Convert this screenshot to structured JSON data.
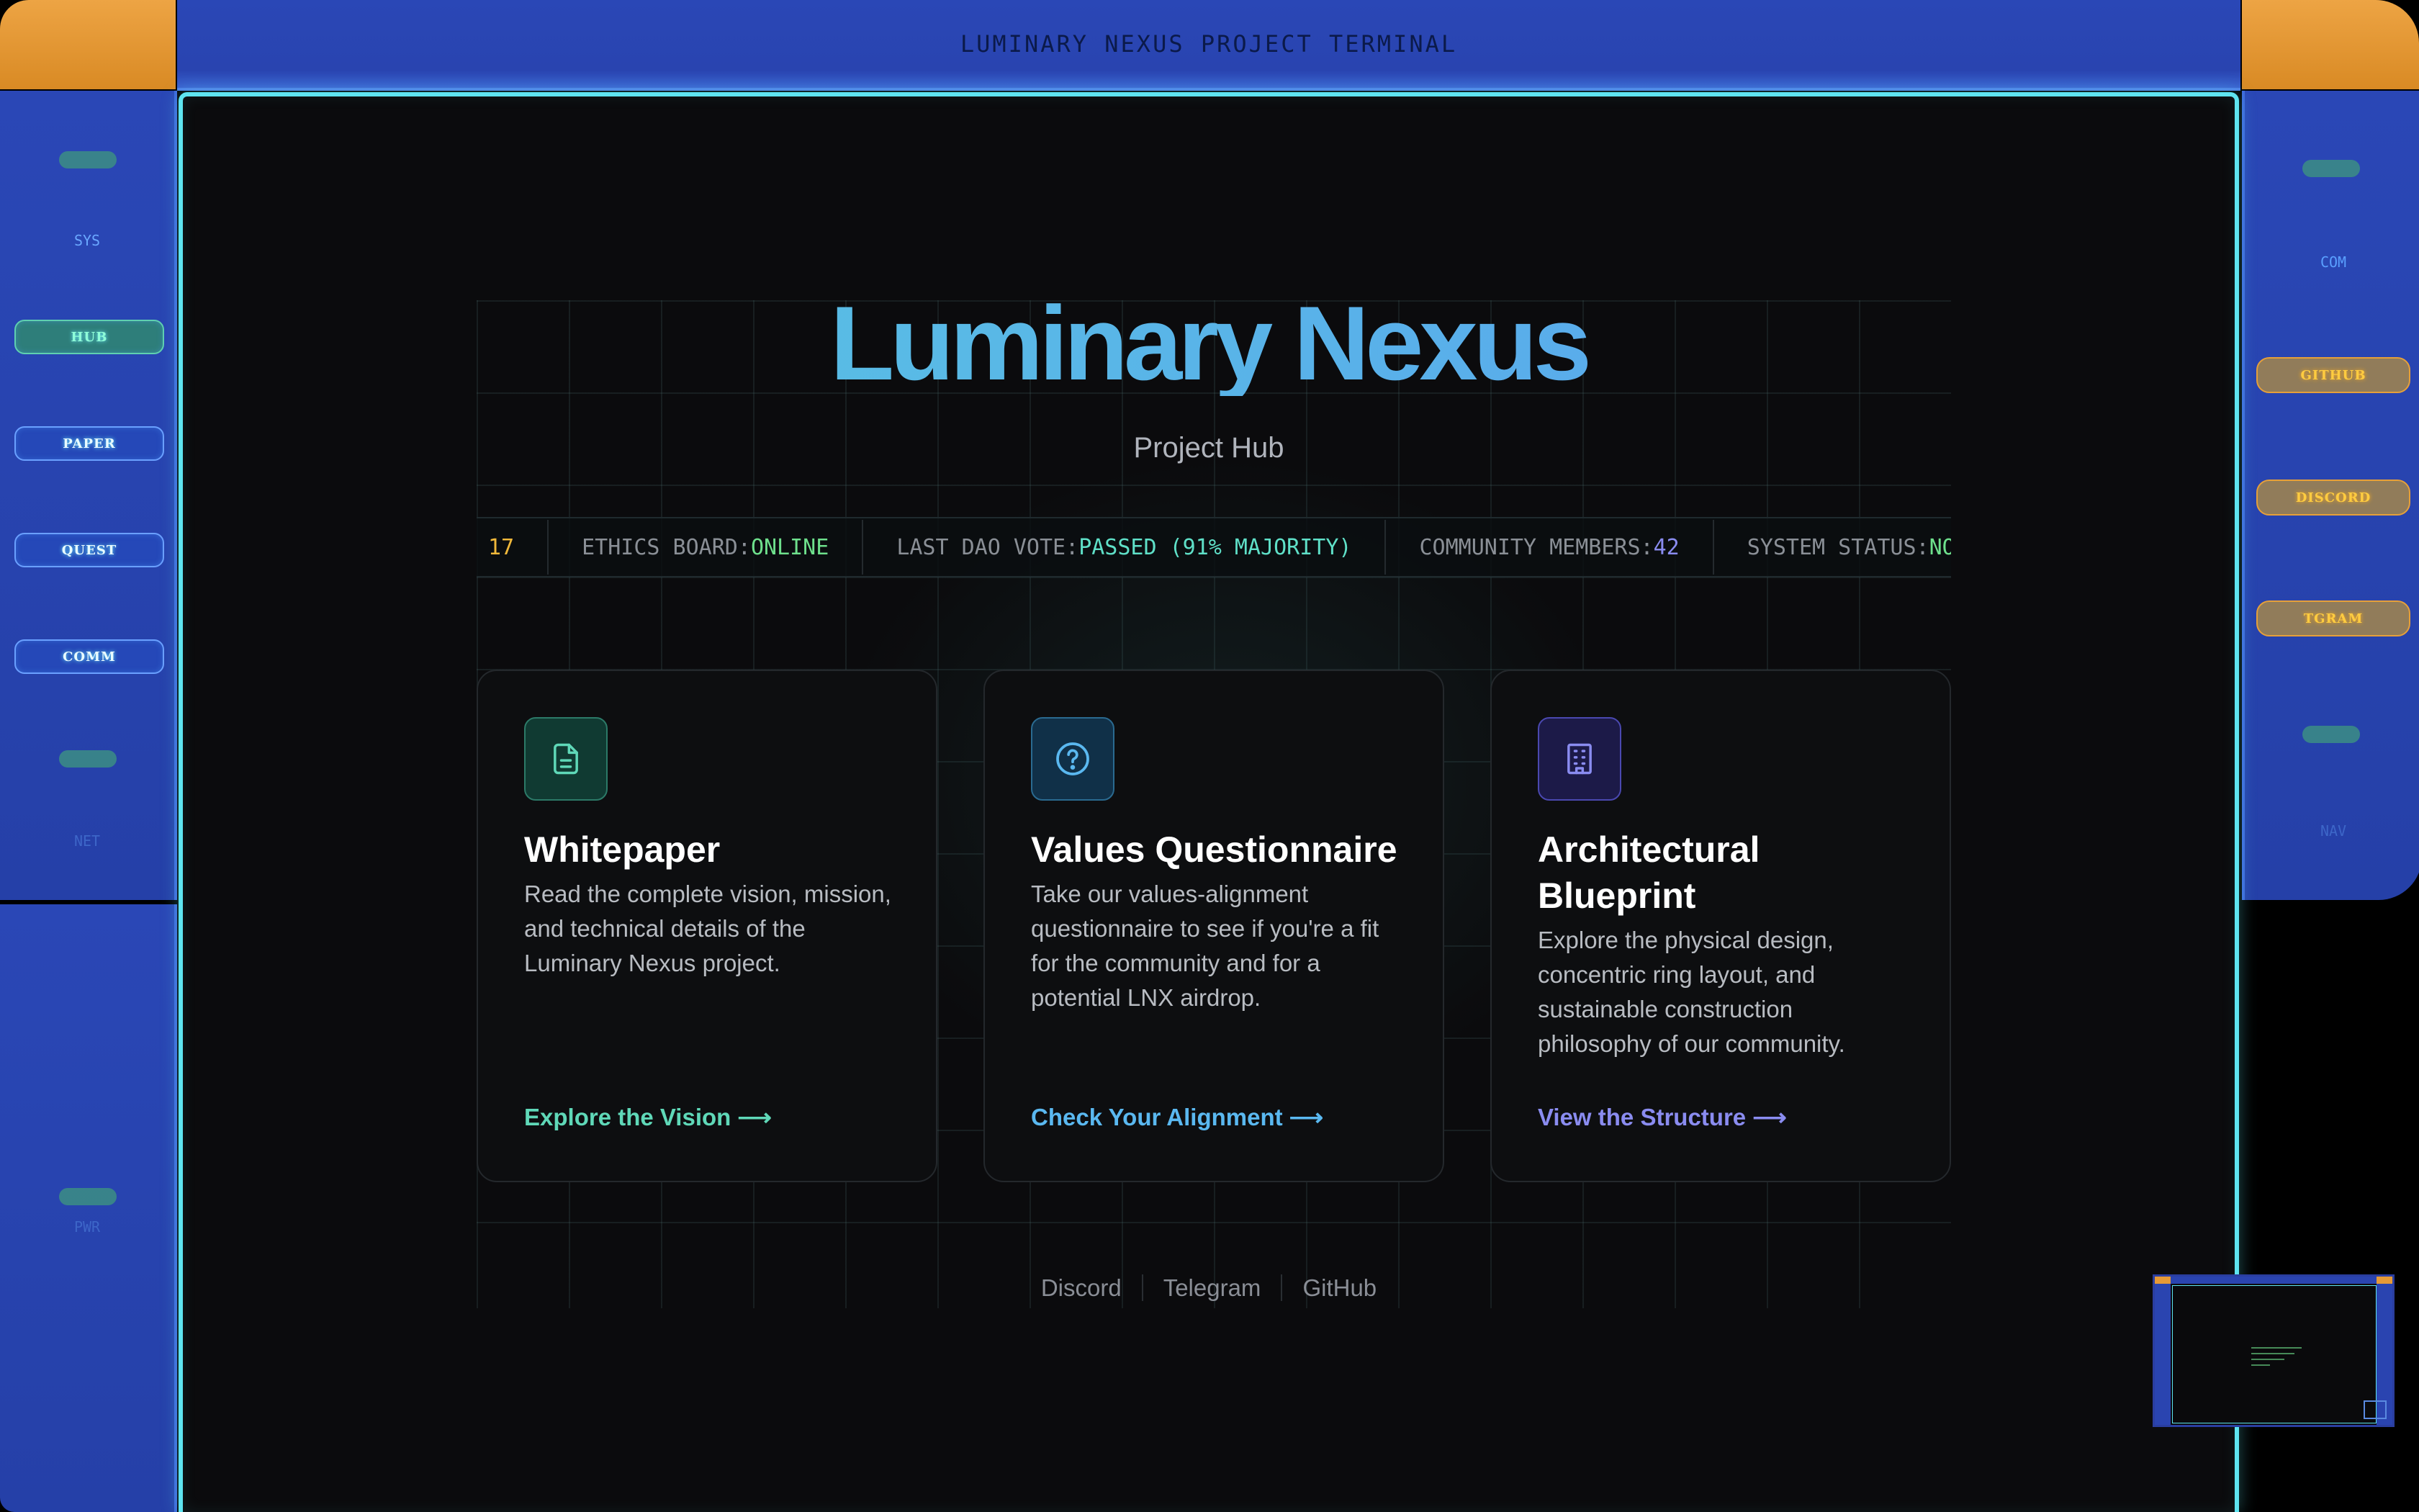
{
  "top_bar": {
    "title": "LUMINARY NEXUS PROJECT TERMINAL"
  },
  "left_panel": {
    "labels": {
      "sys": "SYS",
      "net": "NET",
      "pwr": "PWR"
    },
    "nav": [
      {
        "label": "HUB",
        "active": true
      },
      {
        "label": "PAPER",
        "active": false
      },
      {
        "label": "QUEST",
        "active": false
      },
      {
        "label": "COMM",
        "active": false
      }
    ]
  },
  "right_panel": {
    "labels": {
      "com": "COM",
      "nav": "NAV"
    },
    "links": [
      {
        "label": "GITHUB"
      },
      {
        "label": "DISCORD"
      },
      {
        "label": "TGRAM"
      }
    ]
  },
  "hero": {
    "title": "Luminary Nexus",
    "subtitle": "Project Hub"
  },
  "ticker": [
    {
      "label": "",
      "value": "17",
      "color": "#f0b83a"
    },
    {
      "label": "ETHICS BOARD: ",
      "value": "ONLINE",
      "color": "#6ee08c"
    },
    {
      "label": "LAST DAO VOTE: ",
      "value": "PASSED (91% MAJORITY)",
      "color": "#5fe0c8"
    },
    {
      "label": "COMMUNITY MEMBERS: ",
      "value": "42",
      "color": "#8a8cf0"
    },
    {
      "label": "SYSTEM STATUS: ",
      "value": "NO",
      "color": "#6ee08c"
    }
  ],
  "cards": [
    {
      "icon": "document-icon",
      "title": "Whitepaper",
      "description": "Read the complete vision, mission, and technical details of the Luminary Nexus project.",
      "link": "Explore the Vision",
      "accent": "#5fd8b8"
    },
    {
      "icon": "question-circle-icon",
      "title": "Values Questionnaire",
      "description": "Take our values-alignment questionnaire to see if you're a fit for the community and for a potential LNX airdrop.",
      "link": "Check Your Alignment",
      "accent": "#5ab8f0"
    },
    {
      "icon": "building-icon",
      "title": "Architectural Blueprint",
      "description": "Explore the physical design, concentric ring layout, and sustainable construction philosophy of our community.",
      "link": "View the Structure",
      "accent": "#8a8cf0"
    }
  ],
  "footer": {
    "links": [
      "Discord",
      "Telegram",
      "GitHub"
    ]
  },
  "arrow": "⟶"
}
